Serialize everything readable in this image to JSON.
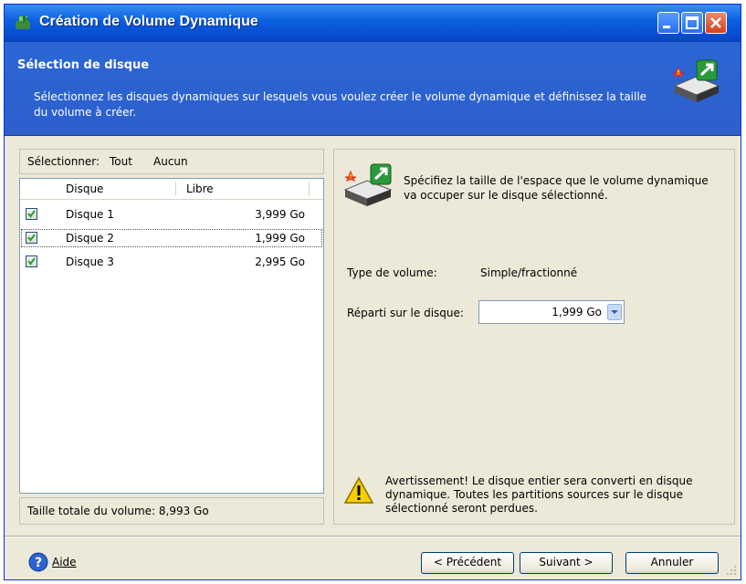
{
  "window": {
    "title": "Création de Volume Dynamique"
  },
  "header": {
    "title": "Sélection de disque",
    "description": "Sélectionnez les disques dynamiques sur lesquels vous voulez créer le volume dynamique et définissez la taille du volume à créer."
  },
  "selection": {
    "label": "Sélectionner:",
    "all": "Tout",
    "none": "Aucun"
  },
  "disk_list": {
    "columns": [
      "Disque",
      "Libre"
    ],
    "rows": [
      {
        "name": "Disque 1",
        "free": "3,999 Go",
        "checked": true
      },
      {
        "name": "Disque 2",
        "free": "1,999 Go",
        "checked": true
      },
      {
        "name": "Disque 3",
        "free": "2,995 Go",
        "checked": true
      }
    ]
  },
  "total": "Taille totale du volume: 8,993 Go",
  "right": {
    "description": "Spécifiez la taille de l'espace que le volume dynamique va occuper sur le disque sélectionné.",
    "volume_type_label": "Type de volume:",
    "volume_type_value": "Simple/fractionné",
    "repart_label": "Réparti sur le disque:",
    "repart_value": "1,999 Go",
    "warning": "Avertissement! Le disque entier sera converti en disque dynamique. Toutes les partitions sources sur le disque sélectionné seront perdues."
  },
  "footer": {
    "help": "Aide",
    "prev": "< Précédent",
    "next": "Suivant >",
    "cancel": "Annuler"
  },
  "colors": {
    "titlebar": "#0a5fe0",
    "header": "#2b66d6",
    "window_bg": "#ece9d8",
    "warning": "#f5d000"
  },
  "icons": [
    "app-icon",
    "minimize-icon",
    "maximize-icon",
    "close-icon",
    "disk-wizard-icon",
    "checkbox-check-icon",
    "spin-down-icon",
    "warning-icon",
    "help-icon",
    "resize-grip-icon"
  ]
}
